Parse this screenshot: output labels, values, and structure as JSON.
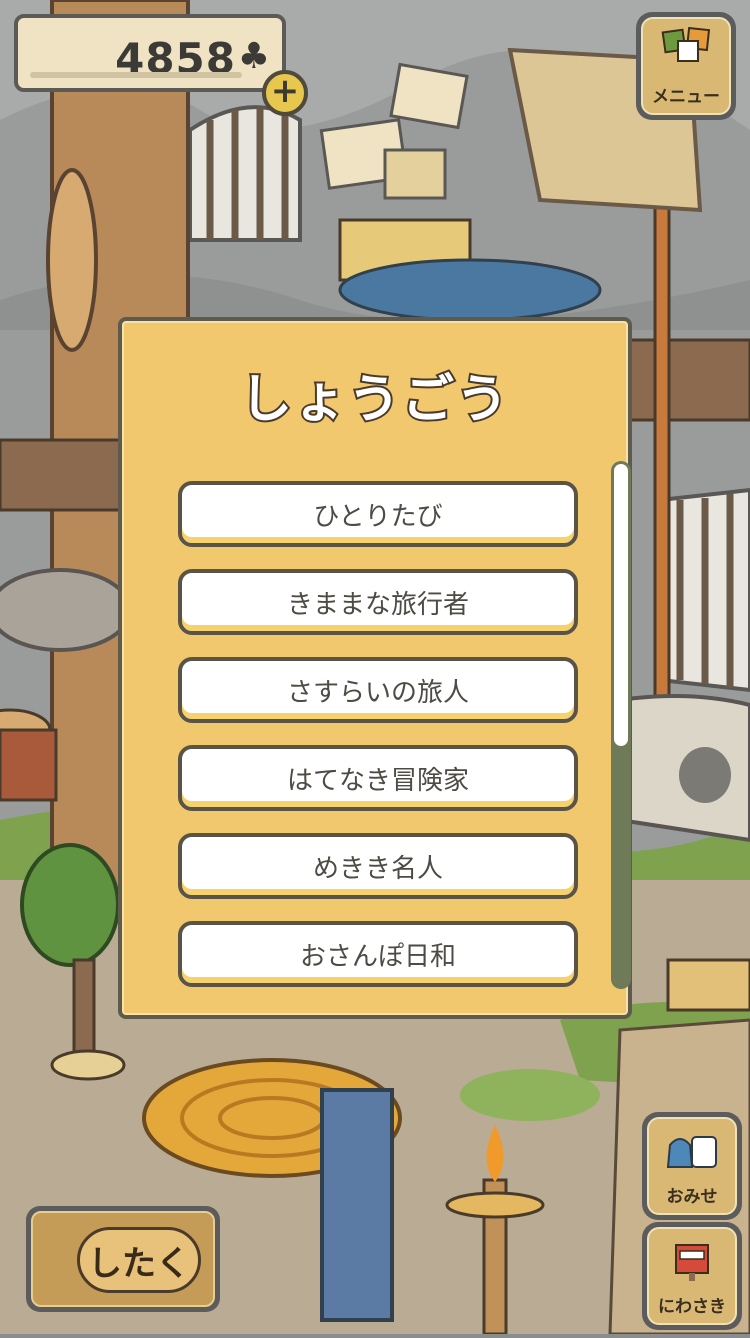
{
  "hud": {
    "clover_count": "4858",
    "clover_symbol": "♣",
    "plus_symbol": "+"
  },
  "menu_button": {
    "label": "メニュー"
  },
  "shop_button": {
    "label": "おみせ"
  },
  "garden_button": {
    "label": "にわさき"
  },
  "prep_button": {
    "label": "したく"
  },
  "modal": {
    "title": "しょうごう",
    "items": [
      "ひとりたび",
      "きままな旅行者",
      "さすらいの旅人",
      "はてなき冒険家",
      "めきき名人",
      "おさんぽ日和"
    ]
  },
  "colors": {
    "modal_bg": "#f2c86e",
    "button_bg": "#d9b874",
    "accent_yellow": "#f5d26e"
  }
}
